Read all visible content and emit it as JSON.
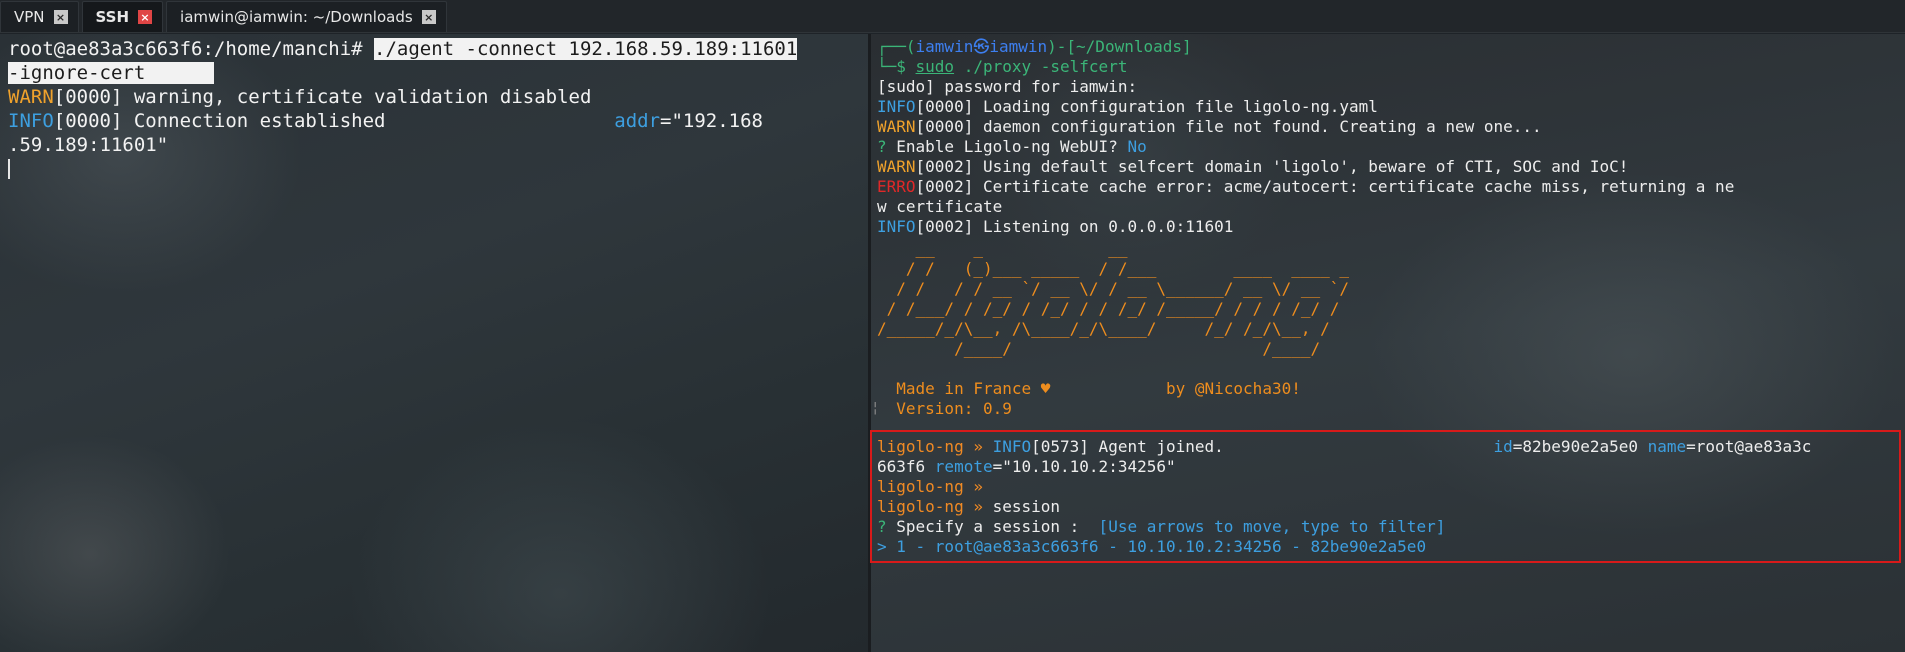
{
  "tabs": [
    {
      "label": "VPN",
      "close": "×",
      "active": false
    },
    {
      "label": "SSH",
      "close": "×",
      "active": true
    },
    {
      "label": "iamwin@iamwin: ~/Downloads",
      "close": "×",
      "active": false
    }
  ],
  "left_terminal": {
    "prompt": "root@ae83a3c663f6:/home/manchi# ",
    "command_line1": "./agent -connect 192.168.59.189:11601",
    "command_line2": "-ignore-cert",
    "warn_tag": "WARN",
    "warn_rest": "[0000] warning, certificate validation disabled",
    "info_tag": "INFO",
    "info_rest": "[0000] Connection established",
    "addr_key": "addr",
    "addr_val": "=\"192.168",
    "addr_wrap": ".59.189:11601\""
  },
  "right_terminal": {
    "prompt_open": "┌──(",
    "user": "iamwin",
    "skull": "㉿",
    "host": "iamwin",
    "prompt_dir": ")-[~/Downloads]",
    "prompt_second": "└─$ ",
    "cmd_sudo": "sudo",
    "cmd_rest": " ./proxy -selfcert",
    "l_password": "[sudo] password for iamwin:",
    "l1_tag": "INFO",
    "l1_rest": "[0000] Loading configuration file ligolo-ng.yaml",
    "l2_tag": "WARN",
    "l2_rest": "[0000] daemon configuration file not found. Creating a new one...",
    "l3_q": "? ",
    "l3_text": "Enable Ligolo-ng WebUI? ",
    "l3_ans": "No",
    "l4_tag": "WARN",
    "l4_rest": "[0002] Using default selfcert domain 'ligolo', beware of CTI, SOC and IoC!",
    "l5_tag": "ERRO",
    "l5_rest": "[0002] Certificate cache error: acme/autocert: certificate cache miss, returning a ne",
    "l5_wrap": "w certificate",
    "l6_tag": "INFO",
    "l6_rest": "[0002] Listening on 0.0.0.0:11601",
    "ascii_art": [
      "    __    _             __                       ",
      "   / /   (_)___ _____  / /___        ____  ____ _",
      "  / /   / / __ `/ __ \\/ / __ \\______/ __ \\/ __ `/",
      " / /___/ / /_/ / /_/ / / /_/ /_____/ / / / /_/ / ",
      "/_____/_/\\__, /\\____/_/\\____/     /_/ /_/\\__, /  ",
      "        /____/                          /____/   "
    ],
    "made_in": "  Made in France ♥            by @Nicocha30!",
    "version": "  Version: 0.9",
    "pipe": "¦"
  },
  "session_box": {
    "prompt": "ligolo-ng » ",
    "joined_tag": "INFO",
    "joined_rest": "[0573] Agent joined.",
    "id_key": "id",
    "id_val": "=82be90e2a5e0 ",
    "name_key": "name",
    "name_val": "=root@ae83a3c",
    "wrap_host": "663f6 ",
    "remote_key": "remote",
    "remote_val": "=\"10.10.10.2:34256\"",
    "session_cmd": "session",
    "q_mark": "? ",
    "q_text": "Specify a session : ",
    "q_hint": " [Use arrows to move, type to filter]",
    "selected": "> 1 - root@ae83a3c663f6 - 10.10.10.2:34256 - 82be90e2a5e0"
  },
  "colors": {
    "warn": "#f0a22c",
    "info": "#3d9fe0",
    "erro": "#e02828",
    "highlight_border": "#d81a1a",
    "ascii": "#ee8d1e"
  }
}
